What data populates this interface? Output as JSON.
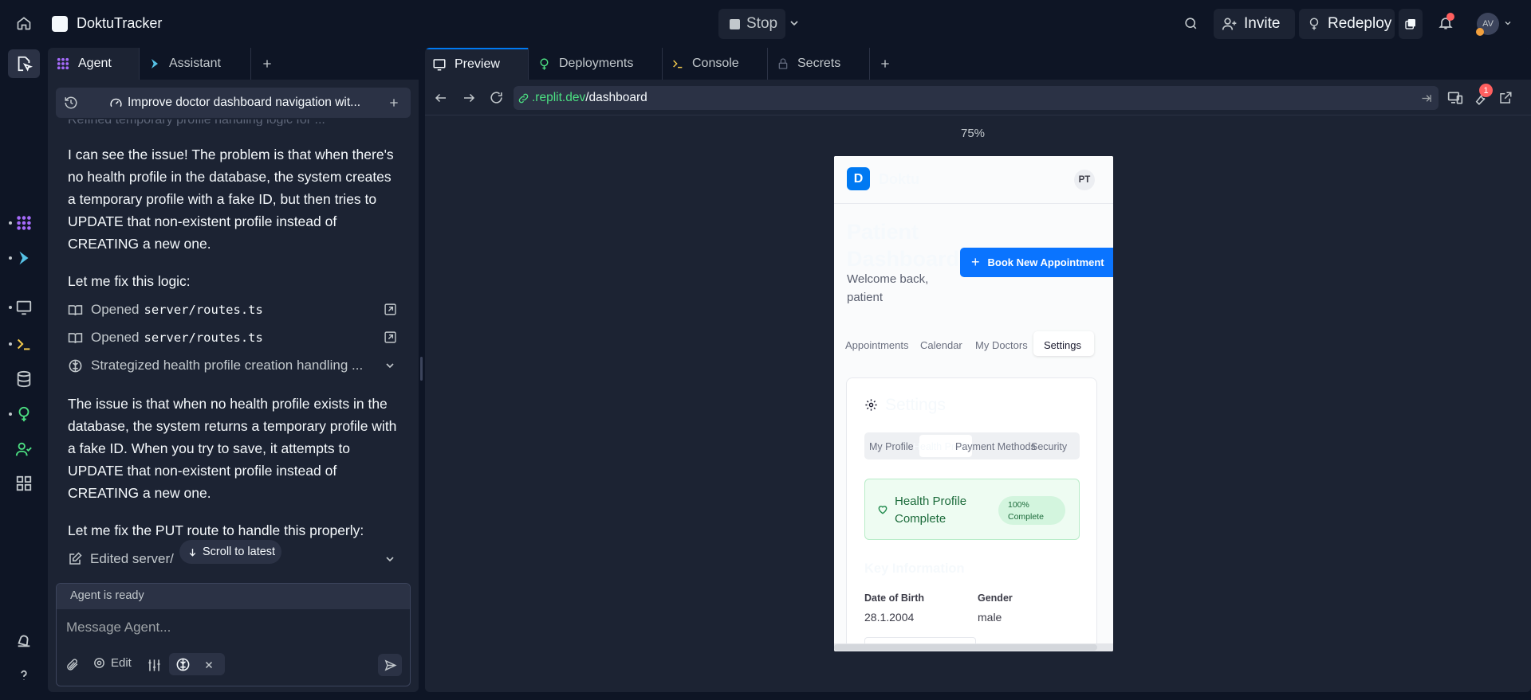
{
  "app": {
    "title": "DoktuTracker"
  },
  "topbar": {
    "stop_label": "Stop",
    "invite_label": "Invite",
    "redeploy_label": "Redeploy",
    "avatar_initials": "AV"
  },
  "left_tabs": {
    "agent": "Agent",
    "assistant": "Assistant"
  },
  "thread": {
    "title": "Improve doctor dashboard navigation wit..."
  },
  "chat": {
    "clipped_line": "Refined temporary profile handling logic for ...",
    "msg1": "I can see the issue! The problem is that when there's no health profile in the database, the system creates a temporary profile with a fake ID, but then tries to UPDATE that non-existent profile instead of CREATING a new one.",
    "msg2": "Let me fix this logic:",
    "tool1_verb": "Opened",
    "tool1_path": "server/routes.ts",
    "tool2_verb": "Opened",
    "tool2_path": "server/routes.ts",
    "strategy": "Strategized health profile creation handling ...",
    "msg3": "The issue is that when no health profile exists in the database, the system returns a temporary profile with a fake ID. When you try to save, it attempts to UPDATE that non-existent profile instead of CREATING a new one.",
    "msg4": "Let me fix the PUT route to handle this properly:",
    "edited": "Edited server/",
    "scroll_latest": "Scroll to latest"
  },
  "composer": {
    "status": "Agent is ready",
    "placeholder": "Message Agent...",
    "edit_label": "Edit"
  },
  "right_tabs": {
    "preview": "Preview",
    "deployments": "Deployments",
    "console": "Console",
    "secrets": "Secrets"
  },
  "urlbar": {
    "domain": ".replit.dev",
    "path": "/dashboard",
    "badge_count": "1"
  },
  "zoom": "75%",
  "preview_page": {
    "brand_letter": "D",
    "brand": "Doktu",
    "user_initials": "PT",
    "heading_line1": "Patient",
    "heading_line2": "Dashboard",
    "welcome_line1": "Welcome back,",
    "welcome_line2": "patient",
    "book_button": "Book New Appointment",
    "nav_tabs": [
      "Appointments",
      "Calendar",
      "My Doctors",
      "Settings"
    ],
    "settings_title": "Settings",
    "sub_tabs": [
      "My Profile",
      "Health Profile",
      "Payment Methods",
      "Security"
    ],
    "status_line1": "Health Profile",
    "status_line2": "Complete",
    "status_badge_line1": "100%",
    "status_badge_line2": "Complete",
    "key_info_title": "Key Information",
    "dob_label": "Date of Birth",
    "dob_value": "28.1.2004",
    "gender_label": "Gender",
    "gender_value": "male"
  },
  "colors": {
    "bg": "#0e1525",
    "panel": "#1c2333",
    "accent_blue": "#0079f2",
    "url_green": "#4ce082",
    "notif_red": "#ff5f5f",
    "success_bg": "#eefcf2",
    "success_text": "#1c6b3b"
  }
}
